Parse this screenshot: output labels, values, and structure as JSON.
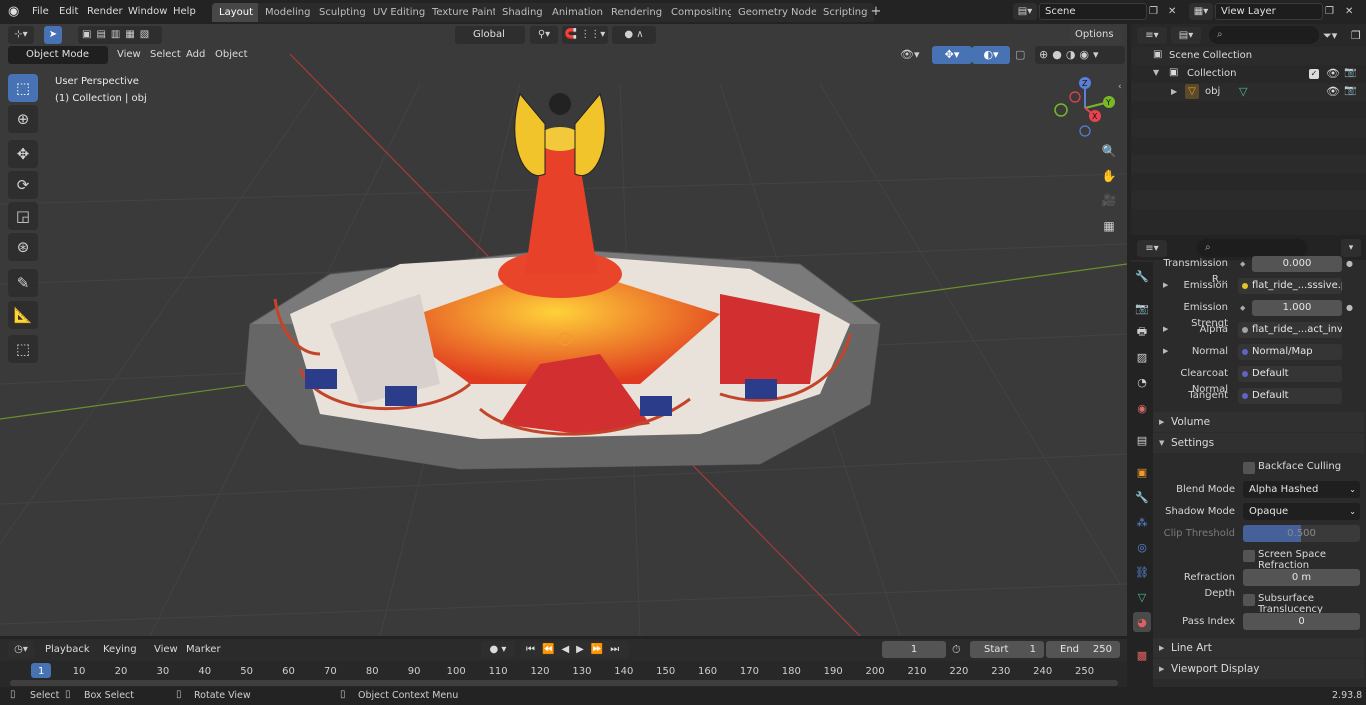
{
  "topbar": {
    "menus": [
      "File",
      "Edit",
      "Render",
      "Window",
      "Help"
    ],
    "workspaces": [
      "Layout",
      "Modeling",
      "Sculpting",
      "UV Editing",
      "Texture Paint",
      "Shading",
      "Animation",
      "Rendering",
      "Compositing",
      "Geometry Nodes",
      "Scripting"
    ],
    "active_workspace": "Layout",
    "add_tab": "+",
    "scene": "Scene",
    "view_layer": "View Layer"
  },
  "viewport": {
    "mode": "Object Mode",
    "menus": [
      "View",
      "Select",
      "Add",
      "Object"
    ],
    "transform_orientation": "Global",
    "options": "Options",
    "overlay_title": "User Perspective",
    "overlay_subtitle": "(1) Collection | obj",
    "gizmo": {
      "z": "Z",
      "y": "Y",
      "x": "X"
    }
  },
  "outliner": {
    "scene_collection": "Scene Collection",
    "collection": "Collection",
    "object": "obj"
  },
  "properties": {
    "rows": [
      {
        "label": "Transmission R...",
        "value": "0.000",
        "kind": "num"
      },
      {
        "label": "Emission",
        "value": "flat_ride_...sssive.png",
        "kind": "tex",
        "expand": true
      },
      {
        "label": "Emission Strengt",
        "value": "1.000",
        "kind": "num"
      },
      {
        "label": "Alpha",
        "value": "flat_ride_...act_inv.png",
        "kind": "tex",
        "expand": true
      },
      {
        "label": "Normal",
        "value": "Normal/Map",
        "kind": "vec",
        "expand": true
      },
      {
        "label": "Clearcoat Normal",
        "value": "Default",
        "kind": "vec"
      },
      {
        "label": "Tangent",
        "value": "Default",
        "kind": "vec"
      }
    ],
    "volume": "Volume",
    "settings": "Settings",
    "backface_culling": "Backface Culling",
    "blend_mode_label": "Blend Mode",
    "blend_mode": "Alpha Hashed",
    "shadow_mode_label": "Shadow Mode",
    "shadow_mode": "Opaque",
    "clip_threshold_label": "Clip Threshold",
    "clip_threshold": "0.500",
    "ssr": "Screen Space Refraction",
    "refraction_depth_label": "Refraction Depth",
    "refraction_depth": "0 m",
    "subsurface": "Subsurface Translucency",
    "pass_index_label": "Pass Index",
    "pass_index": "0",
    "line_art": "Line Art",
    "viewport_display": "Viewport Display"
  },
  "timeline": {
    "menus": [
      "Playback",
      "Keying",
      "View",
      "Marker"
    ],
    "current_frame": "1",
    "start_label": "Start",
    "start": "1",
    "end_label": "End",
    "end": "250",
    "ticks": [
      "1",
      "10",
      "20",
      "30",
      "40",
      "50",
      "60",
      "70",
      "80",
      "90",
      "100",
      "110",
      "120",
      "130",
      "140",
      "150",
      "160",
      "170",
      "180",
      "190",
      "200",
      "210",
      "220",
      "230",
      "240",
      "250"
    ]
  },
  "status": {
    "select": "Select",
    "box_select": "Box Select",
    "rotate_view": "Rotate View",
    "context_menu": "Object Context Menu",
    "version": "2.93.8"
  }
}
